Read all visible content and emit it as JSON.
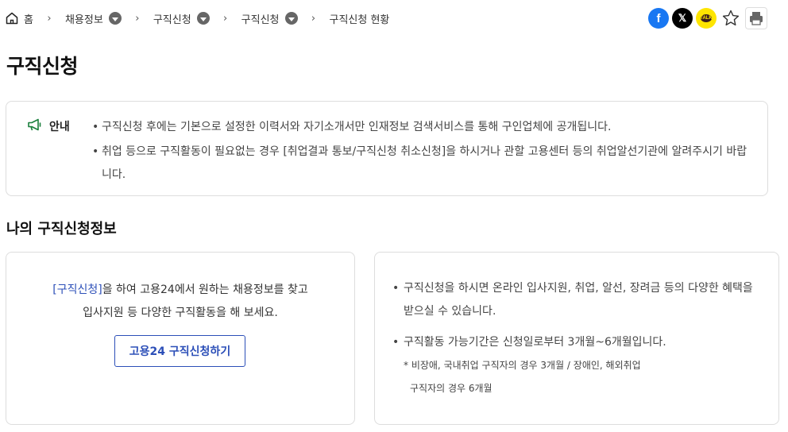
{
  "breadcrumb": {
    "home": "홈",
    "items": [
      "채용정보",
      "구직신청",
      "구직신청",
      "구직신청 현황"
    ]
  },
  "share": {
    "facebook": "f",
    "x": "𝕏",
    "kakao": "TALK",
    "icons": [
      "facebook-icon",
      "x-icon",
      "kakaotalk-icon",
      "star-icon",
      "print-icon"
    ]
  },
  "page_title": "구직신청",
  "notice": {
    "label": "안내",
    "items": [
      "구직신청 후에는 기본으로 설정한 이력서와 자기소개서만 인재정보 검색서비스를 통해 구인업체에 공개됩니다.",
      "취업 등으로 구직활동이 필요없는 경우 [취업결과 통보/구직신청 취소신청]을 하시거나 관할 고용센터 등의 취업알선기관에 알려주시기 바랍니다."
    ]
  },
  "section_title": "나의 구직신청정보",
  "left_card": {
    "highlight": "[구직신청]",
    "text_1": "을 하여 고용24에서 원하는 채용정보를 찾고",
    "text_2": "입사지원 등 다양한 구직활동을 해 보세요.",
    "button": "고용24 구직신청하기"
  },
  "right_card": {
    "item_1": "구직신청을 하시면 온라인 입사지원, 취업, 알선, 장려금 등의 다양한 혜택을 받으실 수 있습니다.",
    "item_2": "구직활동 가능기간은 신청일로부터 3개월~6개월입니다.",
    "note_1": "* 비장애, 국내취업 구직자의 경우 3개월 / 장애인, 해외취업",
    "note_2": "구직자의 경우 6개월"
  },
  "colors": {
    "accent": "#2c4fb8",
    "notice_icon": "#1a7f3c",
    "facebook": "#1877f2",
    "kakao": "#fee500"
  }
}
